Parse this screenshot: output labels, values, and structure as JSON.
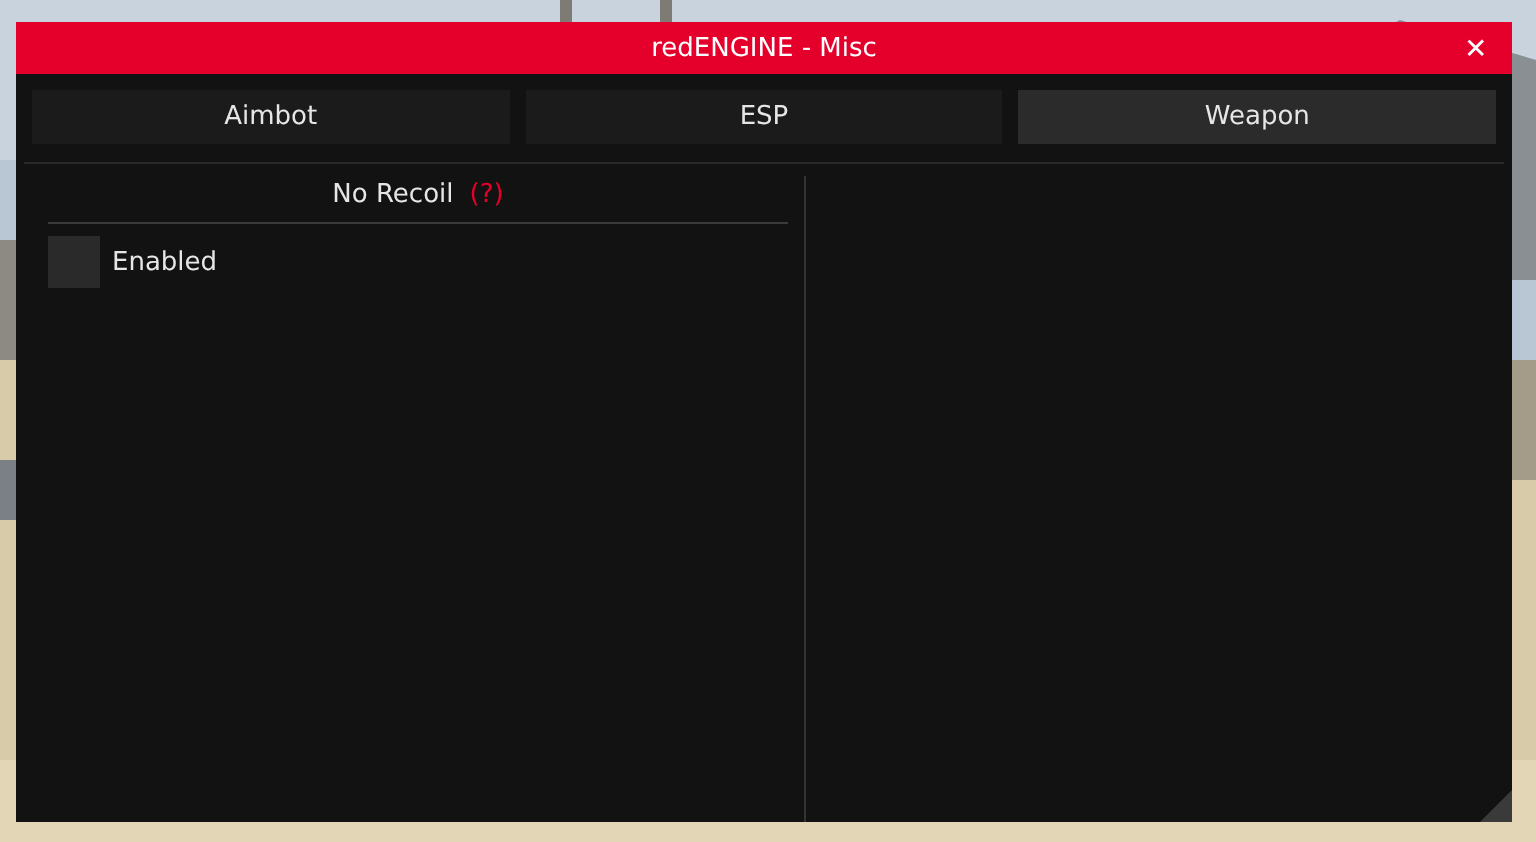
{
  "window": {
    "title": "redENGINE - Misc",
    "close": "✕"
  },
  "tabs": [
    {
      "label": "Aimbot",
      "selected": false
    },
    {
      "label": "ESP",
      "selected": false
    },
    {
      "label": "Weapon",
      "selected": true
    }
  ],
  "left_panel": {
    "heading": "No Recoil",
    "help": "(?)",
    "options": [
      {
        "kind": "checkbox",
        "label": "Enabled",
        "checked": false
      }
    ]
  }
}
